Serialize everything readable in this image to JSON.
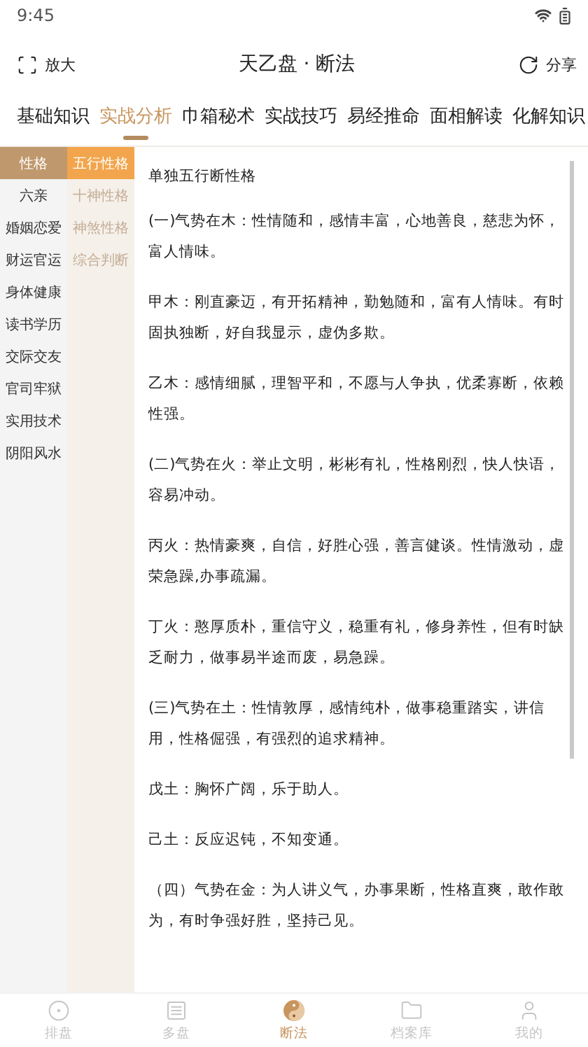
{
  "status_bar": {
    "time": "9:45"
  },
  "header": {
    "left_action": "放大",
    "title": "天乙盘 · 断法",
    "right_action": "分享"
  },
  "tabs": [
    {
      "label": "基础知识",
      "selected": false
    },
    {
      "label": "实战分析",
      "selected": true
    },
    {
      "label": "巾箱秘术",
      "selected": false
    },
    {
      "label": "实战技巧",
      "selected": false
    },
    {
      "label": "易经推命",
      "selected": false
    },
    {
      "label": "面相解读",
      "selected": false
    },
    {
      "label": "化解知识",
      "selected": false
    }
  ],
  "categories": [
    {
      "label": "性格",
      "selected": true
    },
    {
      "label": "六亲",
      "selected": false
    },
    {
      "label": "婚姻恋爱",
      "selected": false
    },
    {
      "label": "财运官运",
      "selected": false
    },
    {
      "label": "身体健康",
      "selected": false
    },
    {
      "label": "读书学历",
      "selected": false
    },
    {
      "label": "交际交友",
      "selected": false
    },
    {
      "label": "官司牢狱",
      "selected": false
    },
    {
      "label": "实用技术",
      "selected": false
    },
    {
      "label": "阴阳风水",
      "selected": false
    }
  ],
  "subcategories": [
    {
      "label": "五行性格",
      "selected": true
    },
    {
      "label": "十神性格",
      "selected": false
    },
    {
      "label": "神煞性格",
      "selected": false
    },
    {
      "label": "综合判断",
      "selected": false
    }
  ],
  "article": {
    "title": "单独五行断性格",
    "paragraphs": [
      "(一)气势在木：性情随和，感情丰富，心地善良，慈悲为怀，富人情味。",
      "甲木：刚直豪迈，有开拓精神，勤勉随和，富有人情味。有时固执独断，好自我显示，虚伪多欺。",
      "乙木：感情细腻，理智平和，不愿与人争执，优柔寡断，依赖性强。",
      "(二)气势在火：举止文明，彬彬有礼，性格刚烈，快人快语，容易冲动。",
      "丙火：热情豪爽，自信，好胜心强，善言健谈。性情激动，虚荣急躁,办事疏漏。",
      "丁火：憨厚质朴，重信守义，稳重有礼，修身养性，但有时缺乏耐力，做事易半途而废，易急躁。",
      "(三)气势在土：性情敦厚，感情纯朴，做事稳重踏实，讲信用，性格倔强，有强烈的追求精神。",
      "戊土：胸怀广阔，乐于助人。",
      "己土：反应迟钝，不知变通。",
      "（四）气势在金：为人讲义气，办事果断，性格直爽，敢作敢为，有时争强好胜，坚持己见。"
    ]
  },
  "bottom_nav": [
    {
      "label": "排盘",
      "kind": "target",
      "selected": false
    },
    {
      "label": "多盘",
      "kind": "list",
      "selected": false
    },
    {
      "label": "断法",
      "kind": "yinyang",
      "selected": true
    },
    {
      "label": "档案库",
      "kind": "folder",
      "selected": false
    },
    {
      "label": "我的",
      "kind": "user",
      "selected": false
    }
  ]
}
